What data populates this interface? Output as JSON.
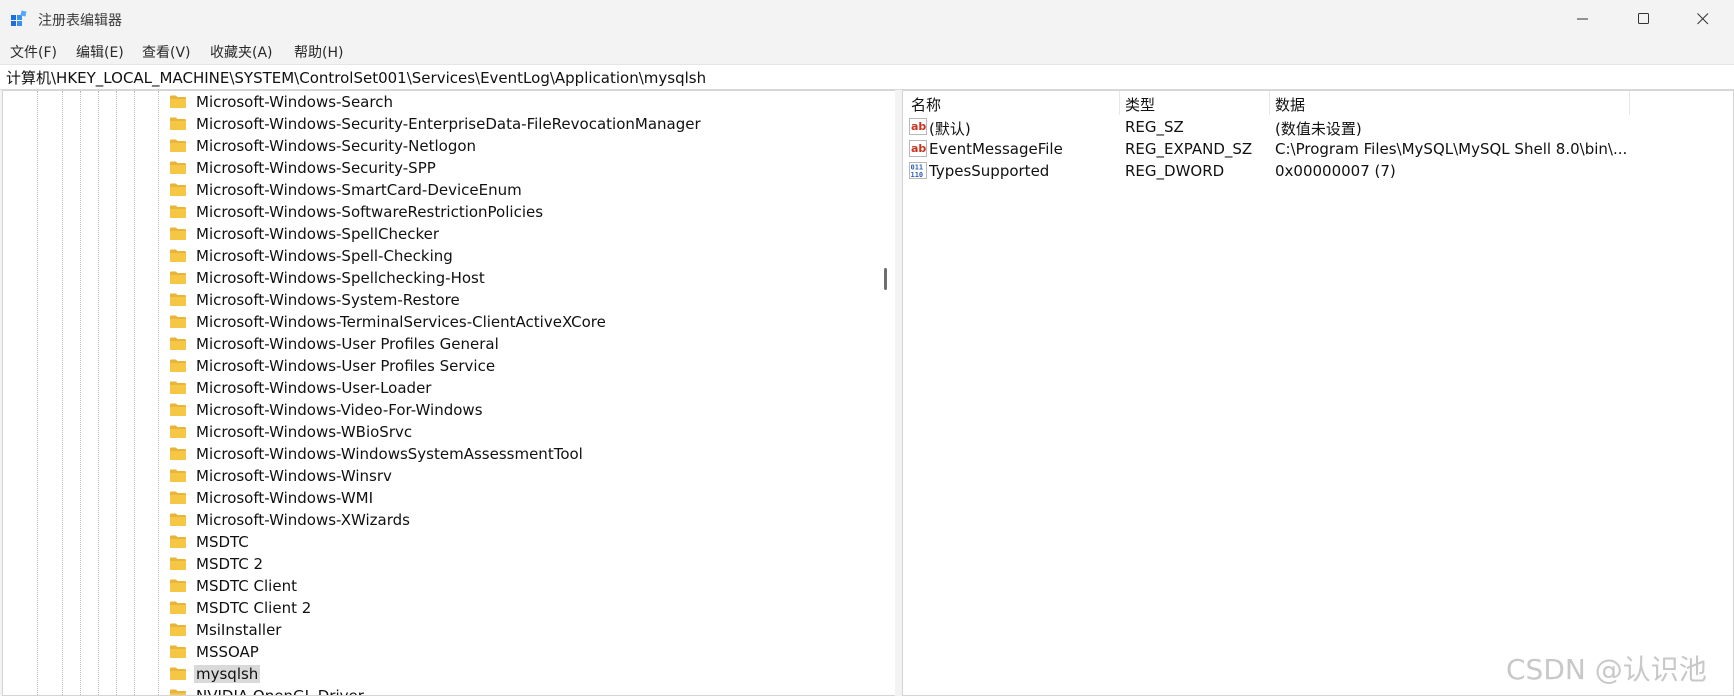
{
  "window": {
    "title": "注册表编辑器"
  },
  "menu": [
    "文件(F)",
    "编辑(E)",
    "查看(V)",
    "收藏夹(A)",
    "帮助(H)"
  ],
  "address": "计算机\\HKEY_LOCAL_MACHINE\\SYSTEM\\ControlSet001\\Services\\EventLog\\Application\\mysqlsh",
  "tree": {
    "items": [
      "Microsoft-Windows-Search",
      "Microsoft-Windows-Security-EnterpriseData-FileRevocationManager",
      "Microsoft-Windows-Security-Netlogon",
      "Microsoft-Windows-Security-SPP",
      "Microsoft-Windows-SmartCard-DeviceEnum",
      "Microsoft-Windows-SoftwareRestrictionPolicies",
      "Microsoft-Windows-SpellChecker",
      "Microsoft-Windows-Spell-Checking",
      "Microsoft-Windows-Spellchecking-Host",
      "Microsoft-Windows-System-Restore",
      "Microsoft-Windows-TerminalServices-ClientActiveXCore",
      "Microsoft-Windows-User Profiles General",
      "Microsoft-Windows-User Profiles Service",
      "Microsoft-Windows-User-Loader",
      "Microsoft-Windows-Video-For-Windows",
      "Microsoft-Windows-WBioSrvc",
      "Microsoft-Windows-WindowsSystemAssessmentTool",
      "Microsoft-Windows-Winsrv",
      "Microsoft-Windows-WMI",
      "Microsoft-Windows-XWizards",
      "MSDTC",
      "MSDTC 2",
      "MSDTC Client",
      "MSDTC Client 2",
      "MsiInstaller",
      "MSSOAP",
      "mysqlsh",
      "NVIDIA OpenGL Driver"
    ],
    "selected": "mysqlsh"
  },
  "values": {
    "headers": {
      "name": "名称",
      "type": "类型",
      "data": "数据"
    },
    "rows": [
      {
        "icon": "string-value-icon",
        "name": "(默认)",
        "type": "REG_SZ",
        "data": "(数值未设置)"
      },
      {
        "icon": "string-value-icon",
        "name": "EventMessageFile",
        "type": "REG_EXPAND_SZ",
        "data": "C:\\Program Files\\MySQL\\MySQL Shell 8.0\\bin\\..."
      },
      {
        "icon": "binary-value-icon",
        "name": "TypesSupported",
        "type": "REG_DWORD",
        "data": "0x00000007 (7)"
      }
    ]
  },
  "watermark": "CSDN @认识池",
  "colors": {
    "folder": "#f6c744",
    "string_icon": "#c8351f",
    "binary_icon": "#2d5fb3",
    "selection": "#d9d9d9"
  }
}
